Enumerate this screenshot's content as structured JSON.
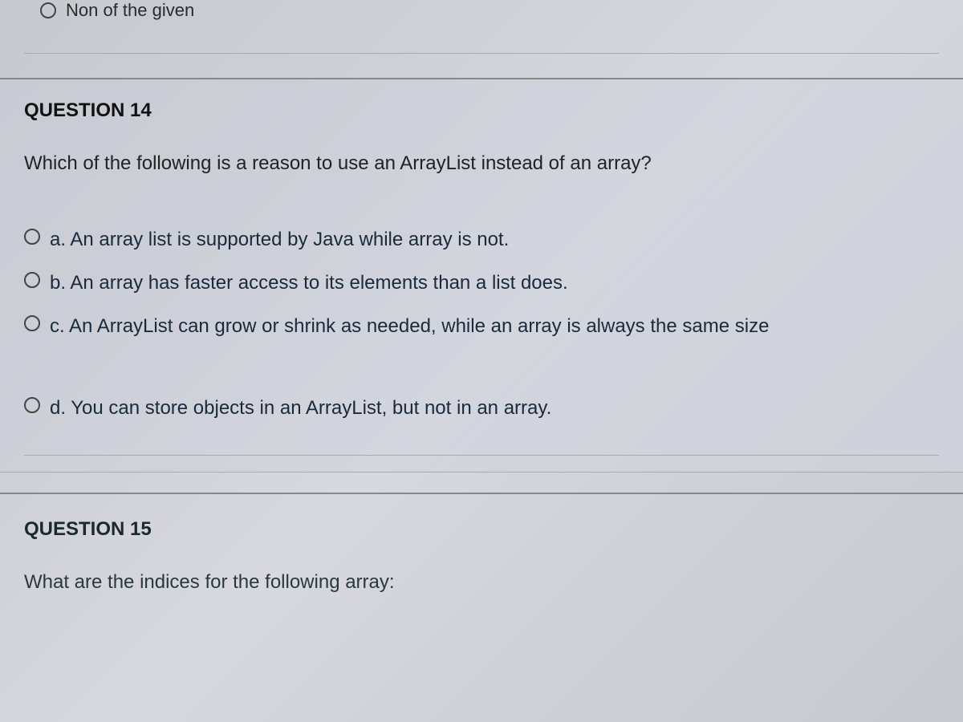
{
  "partial_prev": {
    "option_text": "Non of the given"
  },
  "question14": {
    "header": "QUESTION 14",
    "prompt": "Which of the following is a reason to use an ArrayList instead of an array?",
    "options": [
      {
        "letter": "a.",
        "text": "An array list is supported by Java while array is not."
      },
      {
        "letter": "b.",
        "text": "An array has faster access to its elements than a list does."
      },
      {
        "letter": "c.",
        "text": "An ArrayList can grow or shrink as needed, while an array is always the same size"
      },
      {
        "letter": "d.",
        "text": "You can store objects in an ArrayList, but not in an array."
      }
    ]
  },
  "question15": {
    "header": "QUESTION 15",
    "prompt": "What are the indices for the following array:"
  }
}
